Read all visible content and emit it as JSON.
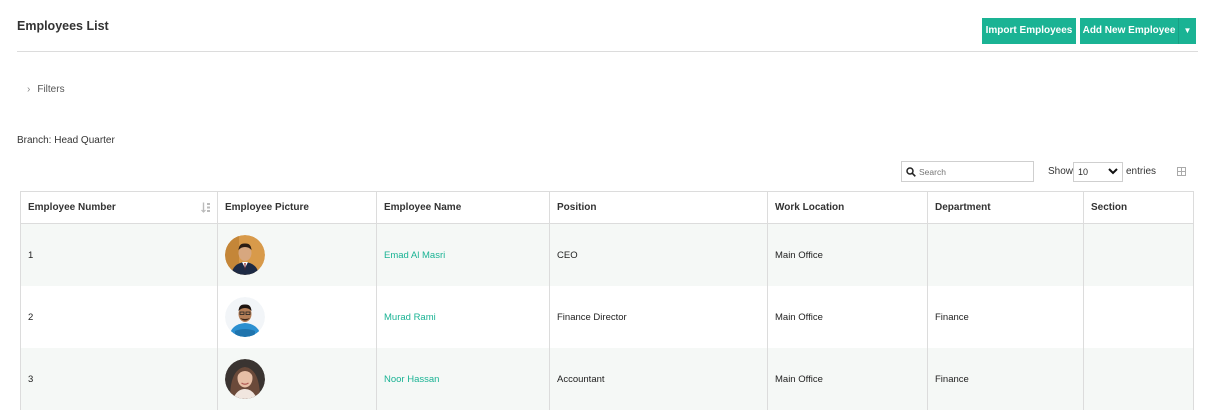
{
  "header": {
    "title": "Employees List",
    "import_label": "Import Employees",
    "add_label": "Add New Employee",
    "accent_color": "#1ab394"
  },
  "filters": {
    "label": "Filters"
  },
  "branch": {
    "label": "Branch: Head Quarter"
  },
  "search": {
    "placeholder": "Search",
    "icon": "search-icon"
  },
  "length": {
    "show_label": "Show",
    "value": "10",
    "entries_label": "entries"
  },
  "table": {
    "columns": [
      "Employee Number",
      "Employee Picture",
      "Employee Name",
      "Position",
      "Work Location",
      "Department",
      "Section"
    ],
    "rows": [
      {
        "number": "1",
        "name": "Emad Al Masri",
        "position": "CEO",
        "work_location": "Main Office",
        "department": "",
        "section": ""
      },
      {
        "number": "2",
        "name": "Murad Rami",
        "position": "Finance Director",
        "work_location": "Main Office",
        "department": "Finance",
        "section": ""
      },
      {
        "number": "3",
        "name": "Noor Hassan",
        "position": "Accountant",
        "work_location": "Main Office",
        "department": "Finance",
        "section": ""
      }
    ]
  }
}
